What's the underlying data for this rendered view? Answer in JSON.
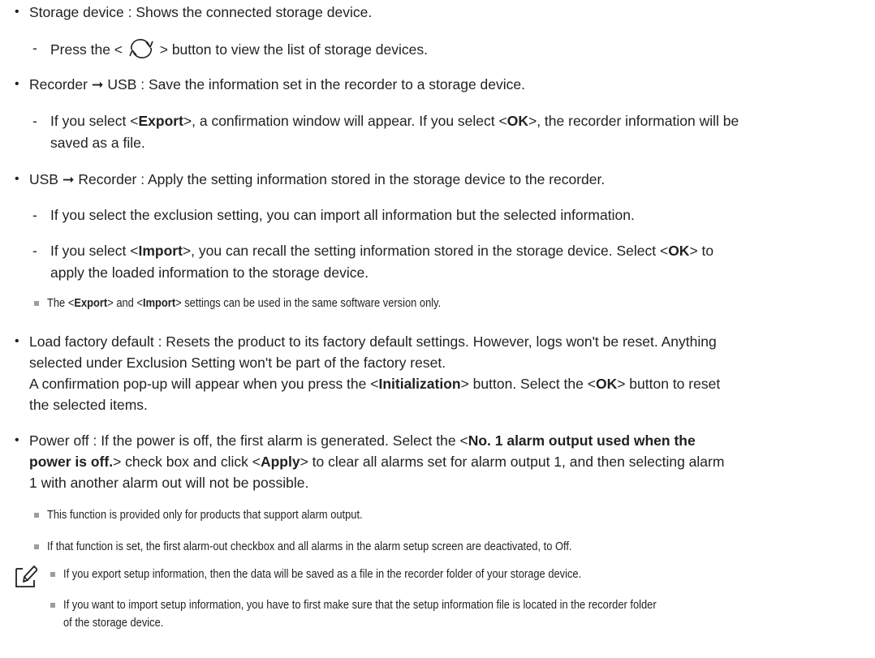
{
  "items": [
    {
      "label": "Storage device",
      "text": " : Shows the connected storage device."
    },
    {
      "label": "Recorder",
      "mid": "USB",
      "text": " : Save the information set in the recorder to a storage device."
    },
    {
      "label": "USB",
      "mid": "Recorder",
      "text": " : Apply the setting information stored in the storage device to the recorder."
    },
    {
      "label": "Load factory default",
      "text": " : Resets the product to its factory default settings. However, logs won't be reset. Anything",
      "line2": "selected under Exclusion Setting won't be part of the factory reset."
    },
    {
      "label": "Power off",
      "text": " : If the power is off, the first alarm is generated. Select the <"
    }
  ],
  "sub1": {
    "pre": "Press the < ",
    "post": " > button to view the list of storage devices."
  },
  "sub2": {
    "a": "If you select <",
    "b": "Export",
    "c": ">, a confirmation window will appear. If you select <",
    "d": "OK",
    "e": ">, the recorder information will be",
    "line2": "saved as a file."
  },
  "sub3": {
    "text": "If you select the exclusion setting, you can import all information but the selected information."
  },
  "sub4": {
    "a": "If you select <",
    "b": "Import",
    "c": ">, you can recall the setting information stored in the storage device. Select <",
    "d": "OK",
    "e": "> to",
    "line2": "apply the loaded information to the storage device."
  },
  "note1": {
    "a": "The <",
    "b": "Export",
    "c": "> and <",
    "d": "Import",
    "e": "> settings can be used in the same software version only."
  },
  "factory": {
    "a": "A confirmation pop-up will appear when you press the <",
    "b": "Initialization",
    "c": "> button. Select the <",
    "d": "OK",
    "e": "> button to reset",
    "line2": "the selected items."
  },
  "power": {
    "b1": "No. 1 alarm output used when the",
    "b2": "power is off.",
    "a2": "> check box and click <",
    "b3": "Apply",
    "a3": "> to clear all alarms set for alarm output 1, and then selecting alarm",
    "line3": "1 with another alarm out will not be possible."
  },
  "notes": [
    "This function is provided only for products that support alarm output.",
    "If that function is set, the first alarm-out checkbox and all alarms in the alarm setup screen are deactivated, to Off."
  ],
  "memo": [
    "If you export setup information, then the data will be saved as a file in the recorder folder of your storage device.",
    "If you want to import setup information, you have to first make sure that the setup information file is located in the recorder folder",
    "of the storage device."
  ],
  "symbols": {
    "arrow": "➞",
    "bullet": "•",
    "dash": "-"
  },
  "icons": [
    "refresh-icon",
    "memo-icon"
  ]
}
